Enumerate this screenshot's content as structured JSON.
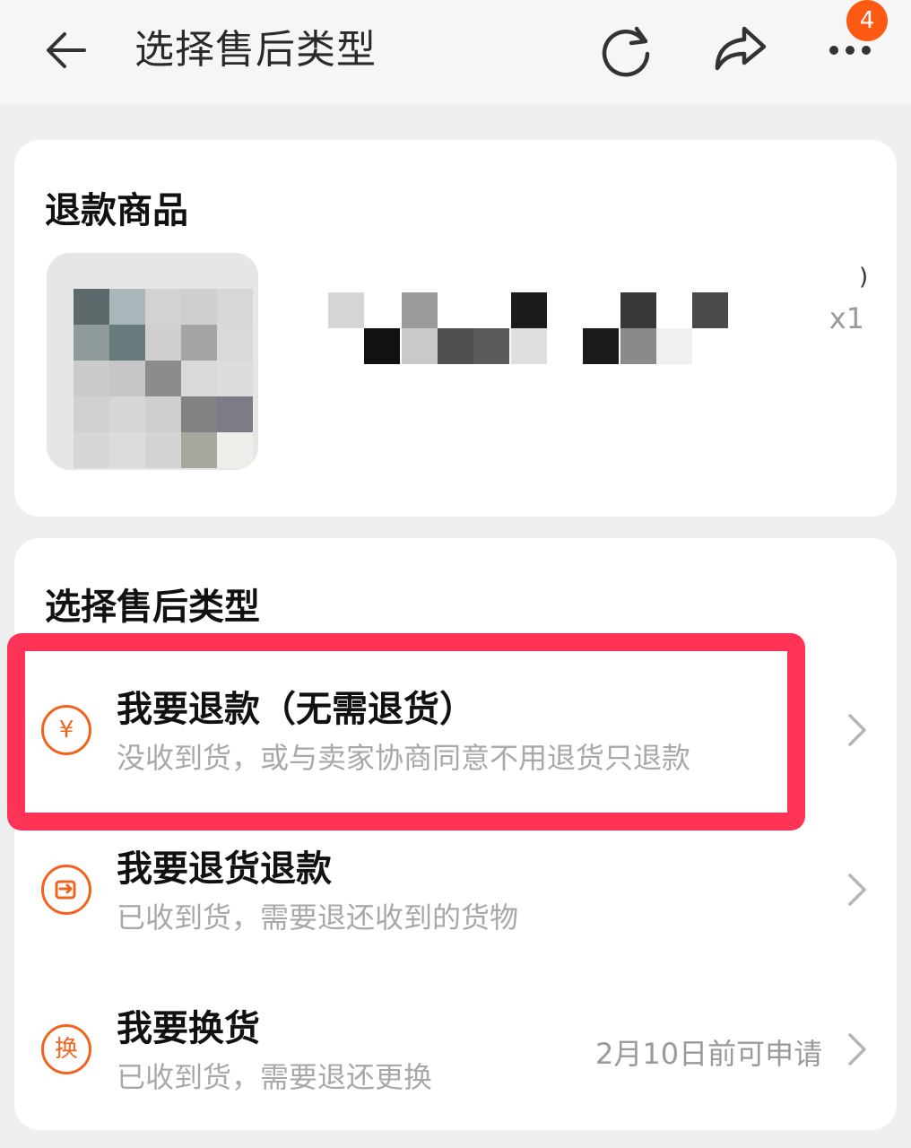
{
  "nav": {
    "title": "选择售后类型",
    "badge_count": "4",
    "icons": [
      "back-arrow-icon",
      "refresh-icon",
      "share-icon",
      "more-icon"
    ]
  },
  "product_card": {
    "title": "退款商品",
    "quantity": "x1",
    "trailing_paren": ")"
  },
  "type_card": {
    "title": "选择售后类型",
    "options": [
      {
        "icon": "¥",
        "icon_name": "yuan-refund-icon",
        "title": "我要退款（无需退货）",
        "subtitle": "没收到货，或与卖家协商同意不用退货只退款",
        "extra": ""
      },
      {
        "icon": "",
        "icon_name": "return-box-icon",
        "title": "我要退货退款",
        "subtitle": "已收到货，需要退还收到的货物",
        "extra": ""
      },
      {
        "icon": "换",
        "icon_name": "exchange-icon",
        "title": "我要换货",
        "subtitle": "已收到货，需要退还更换",
        "extra": "2月10日前可申请"
      }
    ]
  },
  "colors": {
    "accent": "#f0641e",
    "highlight": "#ff3355",
    "badge": "#ff5a14"
  }
}
